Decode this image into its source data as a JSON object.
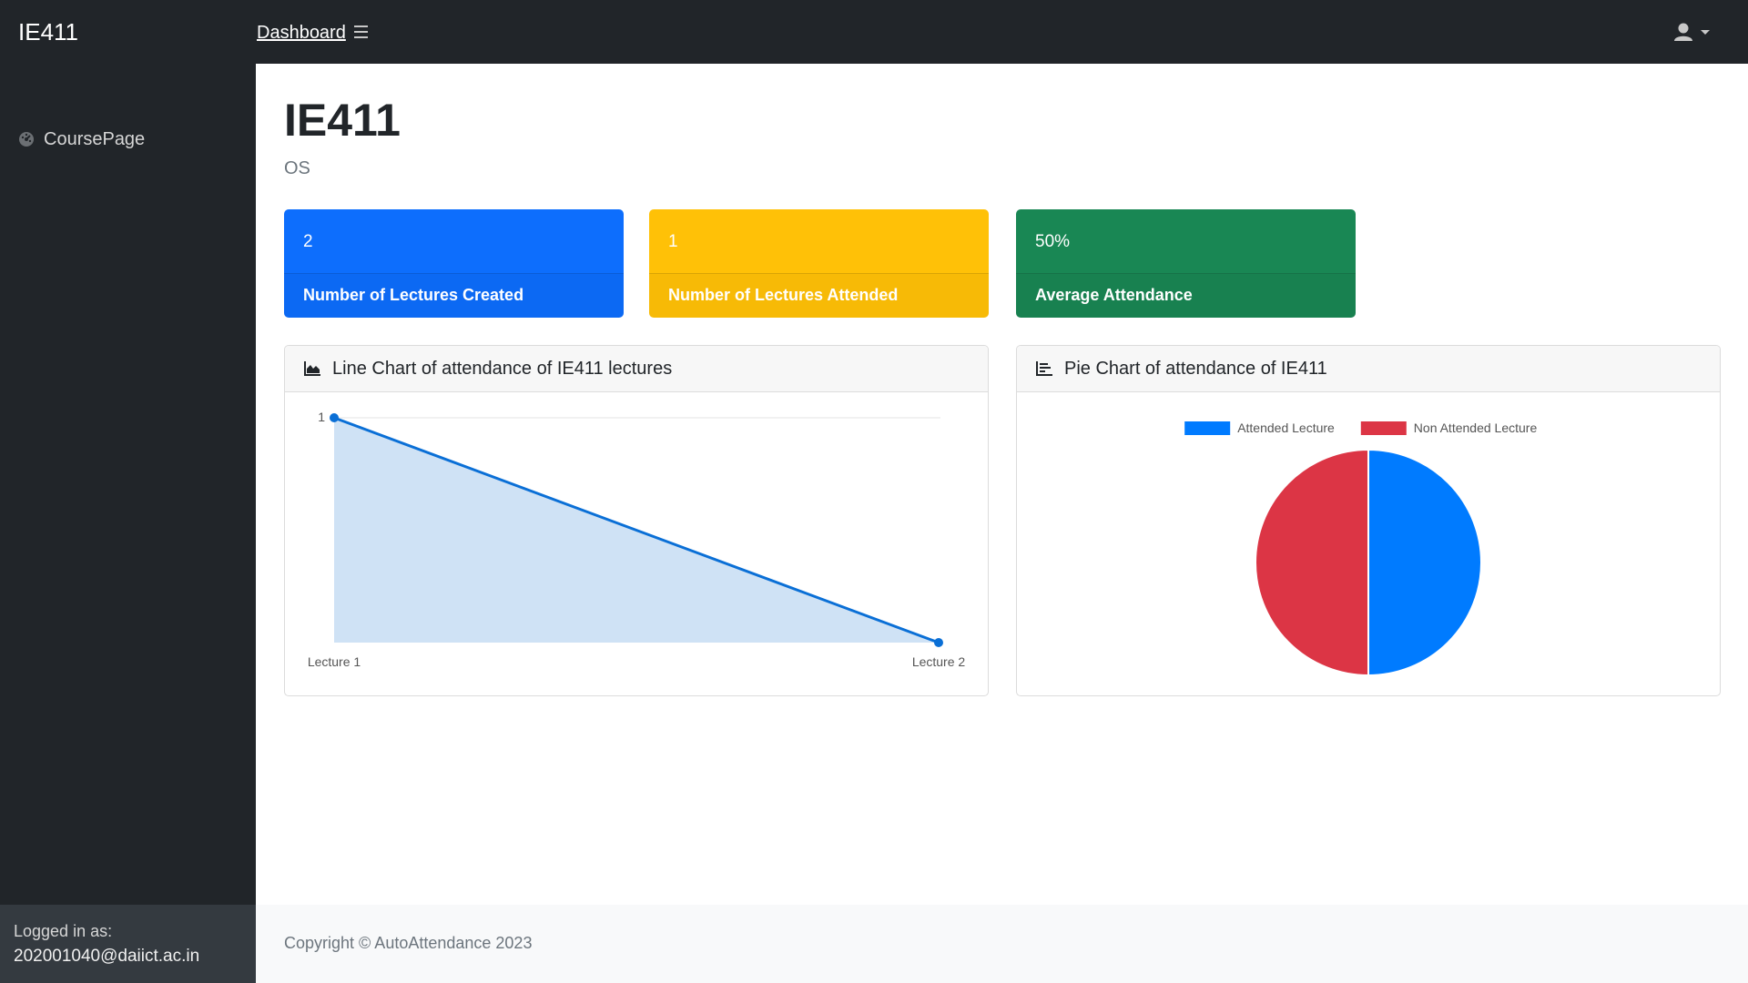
{
  "app": {
    "brand": "IE411"
  },
  "topnav": {
    "link": "Dashboard",
    "menu_icon": "hamburger-icon",
    "user_icon": "user-icon"
  },
  "sidebar": {
    "items": [
      {
        "label": "CoursePage",
        "icon": "tachometer-icon"
      }
    ],
    "footer": {
      "logged_in_label": "Logged in as:",
      "email": "202001040@daiict.ac.in"
    }
  },
  "page": {
    "title": "IE411",
    "subtitle": "OS"
  },
  "stats": [
    {
      "value": "2",
      "label": "Number of Lectures Created",
      "color": "#0d6efd"
    },
    {
      "value": "1",
      "label": "Number of Lectures Attended",
      "color": "#ffc107"
    },
    {
      "value": "50%",
      "label": "Average Attendance",
      "color": "#198754"
    }
  ],
  "line_card": {
    "title": "Line Chart of attendance of IE411 lectures",
    "icon": "area-chart-icon"
  },
  "pie_card": {
    "title": "Pie Chart of attendance of IE411",
    "icon": "bar-chart-icon"
  },
  "chart_data": [
    {
      "type": "area",
      "title": "Line Chart of attendance of IE411 lectures",
      "categories": [
        "Lecture 1",
        "Lecture 2"
      ],
      "series": [
        {
          "values": [
            1,
            0
          ],
          "color": "#0a6fd6",
          "fill": "#cfe2f5"
        }
      ],
      "y_tick_labels": [
        "1"
      ],
      "ylim": [
        0,
        1
      ],
      "grid": true
    },
    {
      "type": "pie",
      "labels": [
        "Attended Lecture",
        "Non Attended Lecture"
      ],
      "values": [
        1,
        1
      ],
      "colors": [
        "#007bff",
        "#dc3545"
      ],
      "legend": "top"
    }
  ],
  "footer": {
    "copyright": "Copyright © AutoAttendance 2023"
  }
}
